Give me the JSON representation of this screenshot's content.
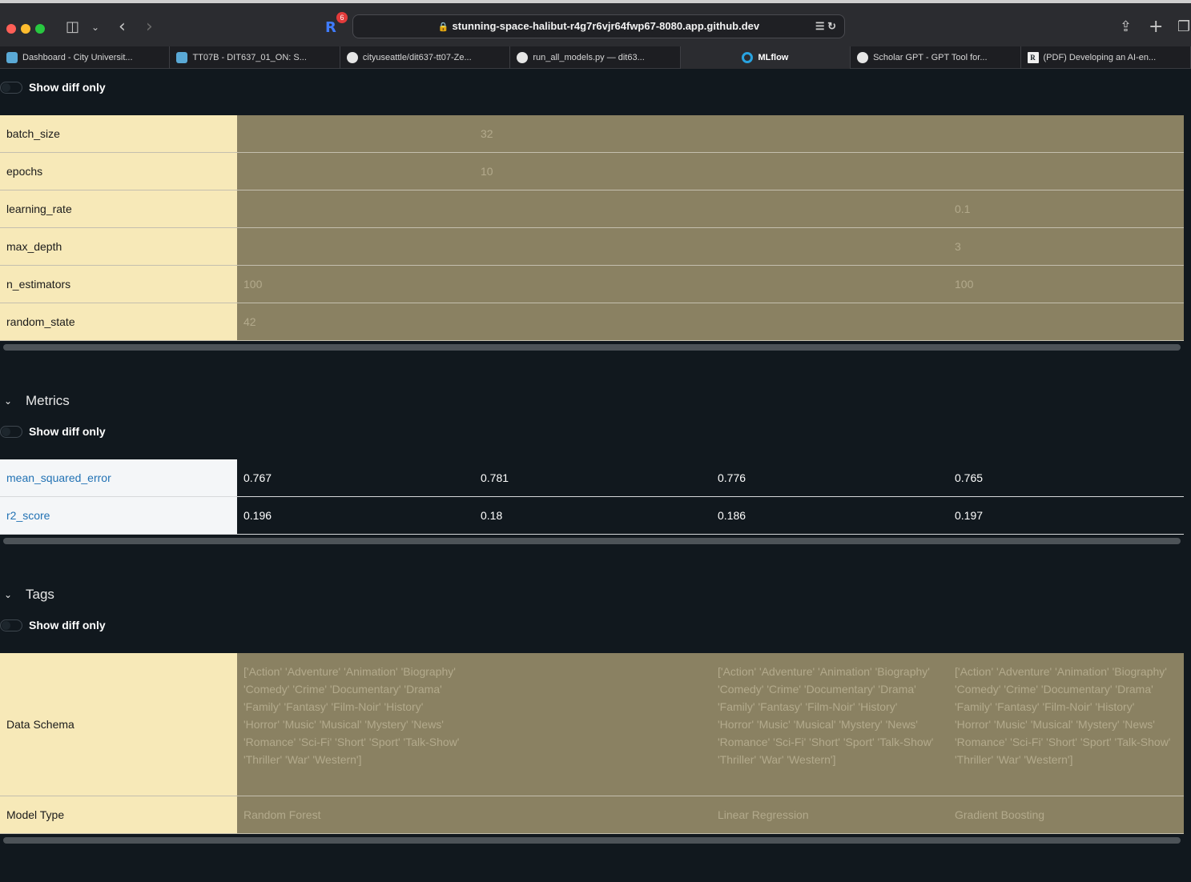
{
  "browser": {
    "address": "stunning-space-halibut-r4g7r6vjr64fwp67-8080.app.github.dev",
    "extension_badge": "6",
    "tabs": [
      {
        "label": "Dashboard - City Universit..."
      },
      {
        "label": "TT07B - DIT637_01_ON: S..."
      },
      {
        "label": "cityuseattle/dit637-tt07-Ze..."
      },
      {
        "label": "run_all_models.py — dit63..."
      },
      {
        "label": "MLflow"
      },
      {
        "label": "Scholar GPT - GPT Tool for..."
      },
      {
        "label": "(PDF) Developing an AI-en..."
      }
    ]
  },
  "parameters": {
    "show_diff_label": "Show diff only",
    "rows": [
      {
        "key": "batch_size",
        "values": [
          "",
          "32",
          "",
          ""
        ]
      },
      {
        "key": "epochs",
        "values": [
          "",
          "10",
          "",
          ""
        ]
      },
      {
        "key": "learning_rate",
        "values": [
          "",
          "",
          "",
          "0.1"
        ]
      },
      {
        "key": "max_depth",
        "values": [
          "",
          "",
          "",
          "3"
        ]
      },
      {
        "key": "n_estimators",
        "values": [
          "100",
          "",
          "",
          "100"
        ]
      },
      {
        "key": "random_state",
        "values": [
          "42",
          "",
          "",
          ""
        ]
      }
    ]
  },
  "metrics": {
    "title": "Metrics",
    "show_diff_label": "Show diff only",
    "rows": [
      {
        "key": "mean_squared_error",
        "values": [
          "0.767",
          "0.781",
          "0.776",
          "0.765"
        ]
      },
      {
        "key": "r2_score",
        "values": [
          "0.196",
          "0.18",
          "0.186",
          "0.197"
        ]
      }
    ]
  },
  "tags": {
    "title": "Tags",
    "show_diff_label": "Show diff only",
    "rows": [
      {
        "key": "Data Schema",
        "values": [
          "['Action' 'Adventure' 'Animation' 'Biography' 'Comedy' 'Crime' 'Documentary' 'Drama' 'Family' 'Fantasy' 'Film-Noir' 'History' 'Horror' 'Music' 'Musical' 'Mystery' 'News' 'Romance' 'Sci-Fi' 'Short' 'Sport' 'Talk-Show' 'Thriller' 'War' 'Western']",
          "",
          "['Action' 'Adventure' 'Animation' 'Biography' 'Comedy' 'Crime' 'Documentary' 'Drama' 'Family' 'Fantasy' 'Film-Noir' 'History' 'Horror' 'Music' 'Musical' 'Mystery' 'News' 'Romance' 'Sci-Fi' 'Short' 'Sport' 'Talk-Show' 'Thriller' 'War' 'Western']",
          "['Action' 'Adventure' 'Animation' 'Biography' 'Comedy' 'Crime' 'Documentary' 'Drama' 'Family' 'Fantasy' 'Film-Noir' 'History' 'Horror' 'Music' 'Musical' 'Mystery' 'News' 'Romance' 'Sci-Fi' 'Short' 'Sport' 'Talk-Show' 'Thriller' 'War' 'Western']"
        ]
      },
      {
        "key": "Model Type",
        "values": [
          "Random Forest",
          "",
          "Linear Regression",
          "Gradient Boosting"
        ]
      }
    ]
  }
}
